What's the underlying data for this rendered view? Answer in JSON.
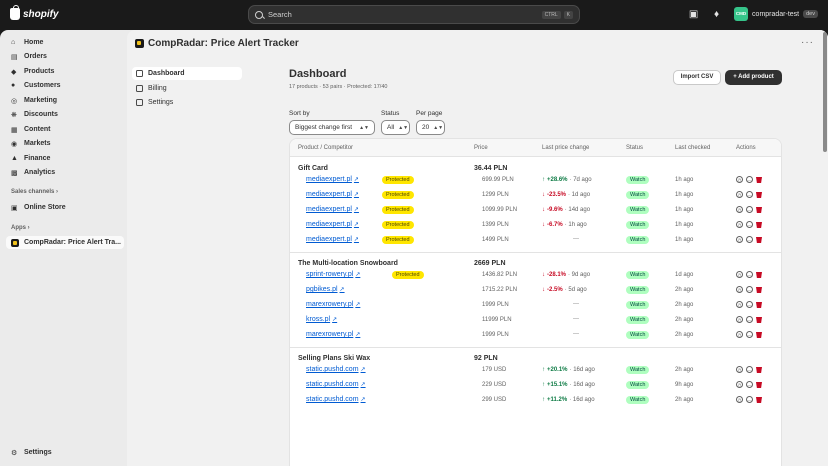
{
  "topbar": {
    "logo": "shopify",
    "search_placeholder": "Search",
    "shortcut_keys": [
      "CTRL",
      "K"
    ],
    "store_initials": "CMD",
    "store_name": "compradar-test",
    "store_badge": "dev"
  },
  "sidebar": {
    "items": [
      {
        "label": "Home",
        "icon": "home-icon"
      },
      {
        "label": "Orders",
        "icon": "orders-icon"
      },
      {
        "label": "Products",
        "icon": "tag-icon"
      },
      {
        "label": "Customers",
        "icon": "person-icon"
      },
      {
        "label": "Marketing",
        "icon": "target-icon"
      },
      {
        "label": "Discounts",
        "icon": "discount-icon"
      },
      {
        "label": "Content",
        "icon": "content-icon"
      },
      {
        "label": "Markets",
        "icon": "globe-icon"
      },
      {
        "label": "Finance",
        "icon": "bank-icon"
      },
      {
        "label": "Analytics",
        "icon": "chart-icon"
      }
    ],
    "sales_channels_label": "Sales channels",
    "sales_channels": [
      {
        "label": "Online Store",
        "icon": "store-icon"
      }
    ],
    "apps_label": "Apps",
    "apps": [
      {
        "label": "CompRadar: Price Alert Tra..."
      }
    ],
    "settings_label": "Settings"
  },
  "app": {
    "title": "CompRadar: Price Alert Tracker",
    "nav": [
      "Dashboard",
      "Billing",
      "Settings"
    ]
  },
  "dashboard": {
    "title": "Dashboard",
    "summary": "17 products · 53 pairs · Protected: 17/40",
    "import_label": "Import CSV",
    "add_label": "+ Add product",
    "filters": {
      "sort_label": "Sort by",
      "sort_value": "Biggest change first",
      "status_label": "Status",
      "status_value": "All",
      "per_page_label": "Per page",
      "per_page_value": "20"
    },
    "columns": [
      "Product / Competitor",
      "Price",
      "Last price change",
      "Status",
      "Last checked",
      "Actions"
    ],
    "groups": [
      {
        "name": "Gift Card",
        "price": "36.44 PLN",
        "rows": [
          {
            "competitor": "mediaexpert.pl",
            "protected": true,
            "price": "699.99 PLN",
            "change": "+28.6%",
            "dir": "up",
            "ago": "· 7d ago",
            "status": "Watch",
            "checked": "1h ago"
          },
          {
            "competitor": "mediaexpert.pl",
            "protected": true,
            "price": "1299 PLN",
            "change": "-23.5%",
            "dir": "down",
            "ago": "· 1d ago",
            "status": "Watch",
            "checked": "1h ago"
          },
          {
            "competitor": "mediaexpert.pl",
            "protected": true,
            "price": "1099.99 PLN",
            "change": "-9.6%",
            "dir": "down",
            "ago": "· 14d ago",
            "status": "Watch",
            "checked": "1h ago"
          },
          {
            "competitor": "mediaexpert.pl",
            "protected": true,
            "price": "1399 PLN",
            "change": "-6.7%",
            "dir": "down",
            "ago": "· 1h ago",
            "status": "Watch",
            "checked": "1h ago"
          },
          {
            "competitor": "mediaexpert.pl",
            "protected": true,
            "price": "1499 PLN",
            "change": "",
            "dir": "none",
            "ago": "—",
            "status": "Watch",
            "checked": "1h ago"
          }
        ]
      },
      {
        "name": "The Multi-location Snowboard",
        "price": "2669 PLN",
        "rows": [
          {
            "competitor": "sprint-rowery.pl",
            "protected": true,
            "price": "1436.82 PLN",
            "change": "-28.1%",
            "dir": "down",
            "ago": "· 9d ago",
            "status": "Watch",
            "checked": "1d ago"
          },
          {
            "competitor": "pgbikes.pl",
            "protected": false,
            "price": "1715.22 PLN",
            "change": "-2.5%",
            "dir": "down",
            "ago": "· 5d ago",
            "status": "Watch",
            "checked": "2h ago"
          },
          {
            "competitor": "marexrowery.pl",
            "protected": false,
            "price": "1999 PLN",
            "change": "",
            "dir": "none",
            "ago": "—",
            "status": "Watch",
            "checked": "2h ago"
          },
          {
            "competitor": "kross.pl",
            "protected": false,
            "price": "11999 PLN",
            "change": "",
            "dir": "none",
            "ago": "—",
            "status": "Watch",
            "checked": "2h ago"
          },
          {
            "competitor": "marexrowery.pl",
            "protected": false,
            "price": "1999 PLN",
            "change": "",
            "dir": "none",
            "ago": "—",
            "status": "Watch",
            "checked": "2h ago"
          }
        ]
      },
      {
        "name": "Selling Plans Ski Wax",
        "price": "92 PLN",
        "rows": [
          {
            "competitor": "static.pushd.com",
            "protected": false,
            "price": "179 USD",
            "change": "+20.1%",
            "dir": "up",
            "ago": "· 16d ago",
            "status": "Watch",
            "checked": "2h ago"
          },
          {
            "competitor": "static.pushd.com",
            "protected": false,
            "price": "229 USD",
            "change": "+15.1%",
            "dir": "up",
            "ago": "· 16d ago",
            "status": "Watch",
            "checked": "9h ago"
          },
          {
            "competitor": "static.pushd.com",
            "protected": false,
            "price": "299 USD",
            "change": "+11.2%",
            "dir": "up",
            "ago": "· 16d ago",
            "status": "Watch",
            "checked": "2h ago"
          }
        ]
      }
    ],
    "protected_label": "Protected"
  }
}
